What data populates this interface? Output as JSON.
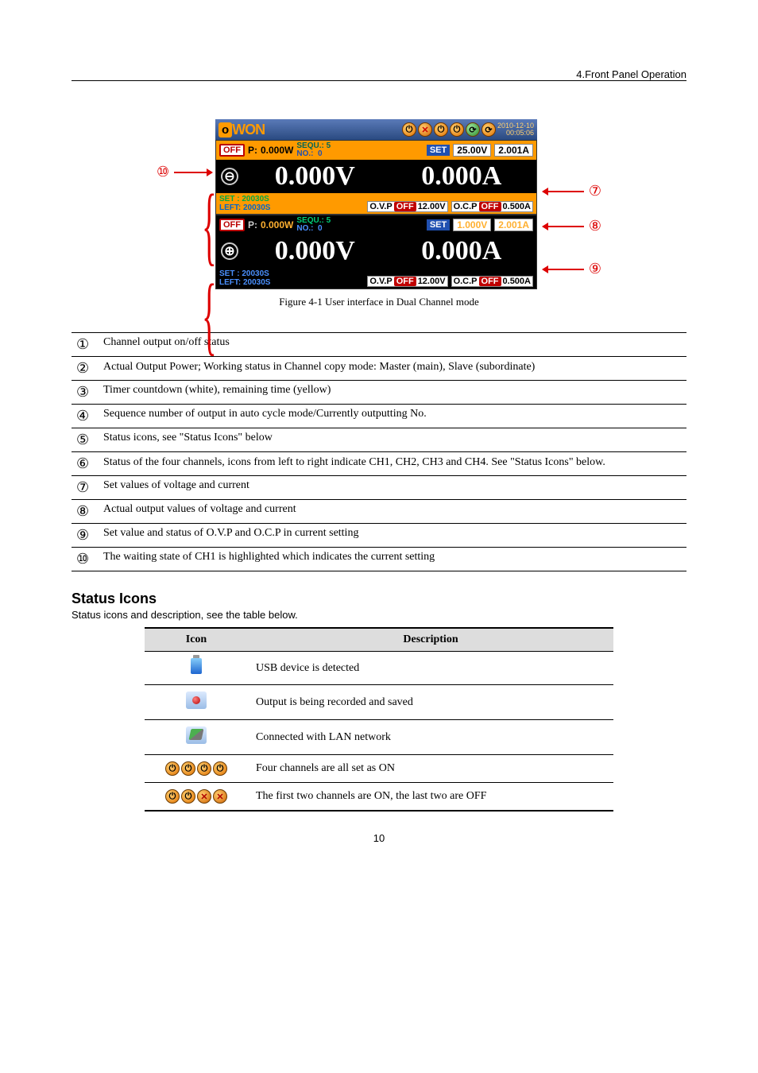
{
  "page_header": "4.Front Panel Operation",
  "callouts": {
    "c1": "①",
    "c2": "②",
    "c3": "③",
    "c4": "④",
    "c5": "⑤",
    "c6": "⑥",
    "c7": "⑦",
    "c8": "⑧",
    "c9": "⑨",
    "c10": "⑩"
  },
  "device": {
    "logo_o": "o",
    "logo_won": "WON",
    "date": "2010-12-10",
    "time": "00:05:06",
    "ch1": {
      "off": "OFF",
      "p_label": "P:",
      "p_val": "0.000W",
      "seq_l1": "SEQU.:",
      "seq_v1": "5",
      "seq_l2": "NO.:",
      "seq_v2": "0",
      "set": "SET",
      "setv": "25.00V",
      "seta": "2.001A",
      "sym": "⊖",
      "bigv": "0.000V",
      "biga": "0.000A",
      "set_t": "SET  : 20030S",
      "left_t": "LEFT: 20030S",
      "ovp": "O.V.P",
      "ovp_off": "OFF",
      "ovp_v": "12.00V",
      "ocp": "O.C.P",
      "ocp_off": "OFF",
      "ocp_a": "0.500A"
    },
    "ch2": {
      "off": "OFF",
      "p_label": "P:",
      "p_val": "0.000W",
      "seq_l1": "SEQU.:",
      "seq_v1": "5",
      "seq_l2": "NO.:",
      "seq_v2": "0",
      "set": "SET",
      "setv": "1.000V",
      "seta": "2.001A",
      "sym": "⊕",
      "bigv": "0.000V",
      "biga": "0.000A",
      "set_t": "SET  : 20030S",
      "left_t": "LEFT: 20030S",
      "ovp": "O.V.P",
      "ovp_off": "OFF",
      "ovp_v": "12.00V",
      "ocp": "O.C.P",
      "ocp_off": "OFF",
      "ocp_a": "0.500A"
    }
  },
  "fig_caption": "Figure 4-1 User interface in Dual Channel mode",
  "desc": [
    {
      "n": "①",
      "t": "Channel output on/off status"
    },
    {
      "n": "②",
      "t": "Actual Output Power; Working status in Channel copy mode: Master (main), Slave (subordinate)"
    },
    {
      "n": "③",
      "t": "Timer countdown (white), remaining time (yellow)"
    },
    {
      "n": "④",
      "t": "Sequence number of output in auto cycle mode/Currently outputting No."
    },
    {
      "n": "⑤",
      "t": "Status icons, see \"Status Icons\" below"
    },
    {
      "n": "⑥",
      "t": "Status of the four channels, icons from left to right indicate CH1, CH2, CH3 and CH4. See \"Status Icons\" below."
    },
    {
      "n": "⑦",
      "t": "Set values of voltage and current"
    },
    {
      "n": "⑧",
      "t": "Actual output values of voltage and current"
    },
    {
      "n": "⑨",
      "t": "Set value and status of O.V.P and O.C.P in current setting"
    },
    {
      "n": "⑩",
      "t": "The waiting state of CH1 is highlighted which indicates the current setting"
    }
  ],
  "icons_title": "Status Icons",
  "icons_sub": "Status icons and description, see the table below.",
  "icons_head_icon": "Icon",
  "icons_head_desc": "Description",
  "icons": [
    {
      "t": "USB device is detected"
    },
    {
      "t": "Output is being recorded and saved"
    },
    {
      "t": "Connected with LAN network"
    },
    {
      "t": "Four channels are all set as ON"
    },
    {
      "t": "The first two channels are ON, the last two are OFF"
    }
  ],
  "page_number": "10"
}
